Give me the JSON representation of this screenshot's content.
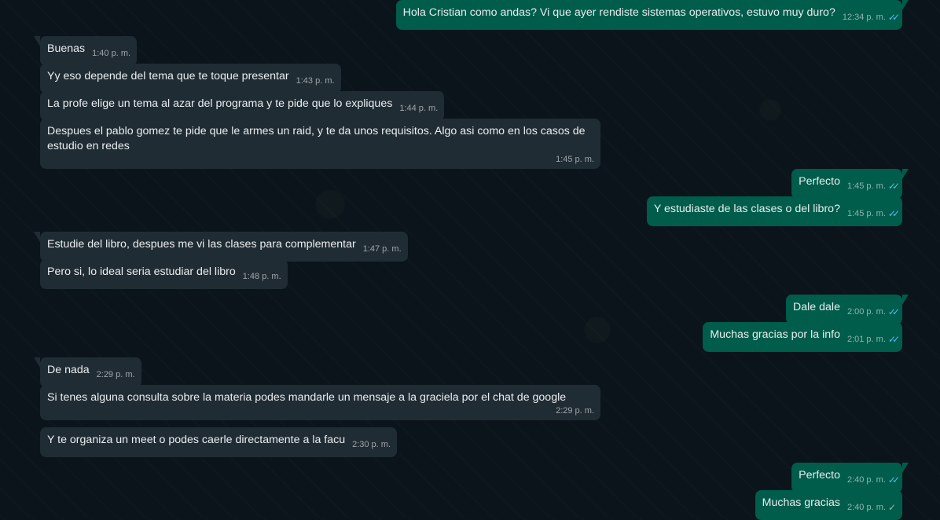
{
  "chat": {
    "messages": [
      {
        "dir": "out",
        "text": "Hola Cristian como andas? Vi que ayer rendiste sistemas operativos, estuvo muy duro?",
        "time": "12:34 p. m.",
        "tick": "✓✓",
        "read": true
      },
      {
        "dir": "in",
        "text": "Buenas",
        "time": "1:40 p. m."
      },
      {
        "dir": "in",
        "text": "Yy eso depende del tema que te toque presentar",
        "time": "1:43 p. m."
      },
      {
        "dir": "in",
        "text": "La profe elige un tema al azar del programa y te pide que lo expliques",
        "time": "1:44 p. m."
      },
      {
        "dir": "in",
        "text": "Despues el pablo gomez te pide que le armes un raid, y te da unos requisitos. Algo asi como en los casos de estudio en redes",
        "time": "1:45 p. m."
      },
      {
        "dir": "out",
        "text": "Perfecto",
        "time": "1:45 p. m.",
        "tick": "✓✓",
        "read": true
      },
      {
        "dir": "out",
        "text": "Y estudiaste de las clases o del libro?",
        "time": "1:45 p. m.",
        "tick": "✓✓",
        "read": true
      },
      {
        "dir": "in",
        "text": "Estudie del libro, despues me vi las clases para complementar",
        "time": "1:47 p. m."
      },
      {
        "dir": "in",
        "text": "Pero si, lo ideal seria estudiar del libro",
        "time": "1:48 p. m."
      },
      {
        "dir": "out",
        "text": "Dale dale",
        "time": "2:00 p. m.",
        "tick": "✓✓",
        "read": true
      },
      {
        "dir": "out",
        "text": "Muchas gracias por la info",
        "time": "2:01 p. m.",
        "tick": "✓✓",
        "read": true
      },
      {
        "dir": "in",
        "text": "De nada",
        "time": "2:29 p. m."
      },
      {
        "dir": "in",
        "text": "Si tenes alguna consulta sobre la materia podes mandarle un mensaje a la  graciela por el chat de google",
        "time": "2:29 p. m."
      },
      {
        "dir": "in",
        "text": "Y te organiza un meet o podes caerle directamente a la facu",
        "time": "2:30 p. m."
      },
      {
        "dir": "out",
        "text": "Perfecto",
        "time": "2:40 p. m.",
        "tick": "✓✓",
        "read": true
      },
      {
        "dir": "out",
        "text": "Muchas gracias",
        "time": "2:40 p. m.",
        "tick": "✓",
        "read": false
      }
    ]
  },
  "colors": {
    "background": "#0b141a",
    "incoming_bubble": "#202c33",
    "outgoing_bubble": "#005c4b",
    "read_tick": "#53bdeb",
    "text": "#e9edef"
  }
}
